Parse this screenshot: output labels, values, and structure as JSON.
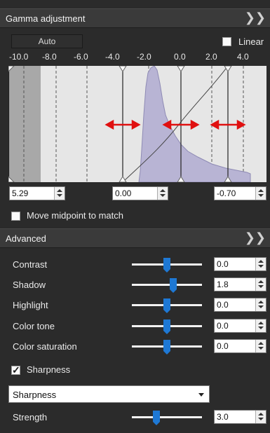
{
  "gamma": {
    "title": "Gamma adjustment",
    "collapse_icon": "double-chevron-down-icon",
    "auto_label": "Auto",
    "linear_label": "Linear",
    "linear_checked": false,
    "ticks": [
      "-10.0",
      "-8.0",
      "-6.0",
      "-4.0",
      "-2.0",
      "0.0",
      "2.0",
      "4.0"
    ],
    "black_point": "5.29",
    "midpoint": "0.00",
    "white_point": "-0.70",
    "move_midpoint_label": "Move midpoint to match",
    "move_midpoint_checked": false
  },
  "advanced": {
    "title": "Advanced",
    "collapse_icon": "double-chevron-down-icon",
    "sliders": [
      {
        "label": "Contrast",
        "value": "0.0",
        "level": 0.5
      },
      {
        "label": "Shadow",
        "value": "1.8",
        "level": 0.59
      },
      {
        "label": "Highlight",
        "value": "0.0",
        "level": 0.5
      },
      {
        "label": "Color tone",
        "value": "0.0",
        "level": 0.5
      },
      {
        "label": "Color saturation",
        "value": "0.0",
        "level": 0.5
      }
    ],
    "sharpness_label": "Sharpness",
    "sharpness_checked": true,
    "sharpness_mode": "Sharpness",
    "strength_label": "Strength",
    "strength_value": "3.0",
    "strength_level": 0.35
  },
  "colors": {
    "accent": "#1e78d4",
    "marker_arrow": "#e01010",
    "histogram_fill": "#b8b4d4"
  }
}
